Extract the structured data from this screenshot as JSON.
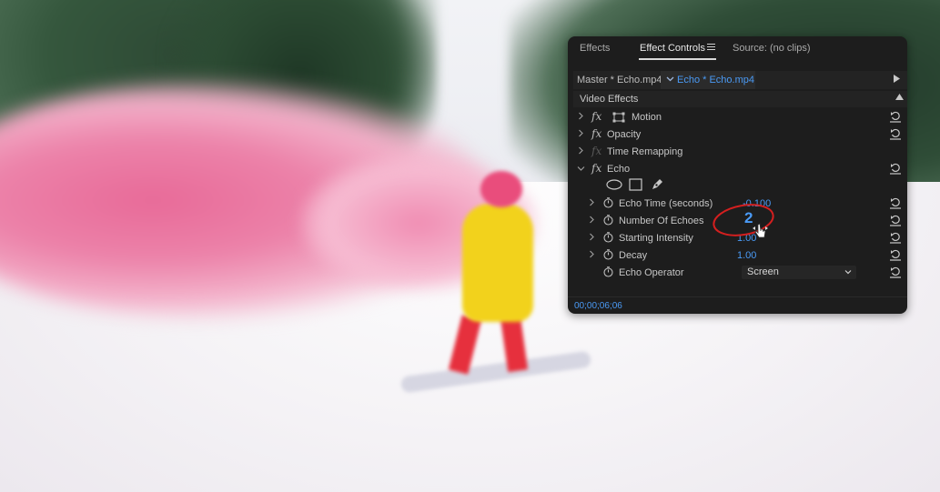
{
  "tabs": {
    "effects": "Effects",
    "effect_controls": "Effect Controls",
    "source": "Source: (no clips)"
  },
  "clips": {
    "master": "Master * Echo.mp4",
    "active": "Echo * Echo.mp4"
  },
  "video_effects": {
    "title": "Video Effects",
    "motion": "Motion",
    "opacity": "Opacity",
    "time_remapping": "Time Remapping",
    "echo": "Echo"
  },
  "echo_params": {
    "echo_time_label": "Echo Time (seconds)",
    "echo_time_value": "-0.100",
    "number_of_echoes_label": "Number Of Echoes",
    "number_of_echoes_value": "2",
    "starting_intensity_label": "Starting Intensity",
    "starting_intensity_value": "1.00",
    "decay_label": "Decay",
    "decay_value": "1.00",
    "echo_operator_label": "Echo Operator",
    "echo_operator_value": "Screen"
  },
  "timecode": "00;00;06;06",
  "colors": {
    "accent_blue": "#4a9af5",
    "panel_bg": "#1d1d1d",
    "annotation_red": "#d41f1f"
  },
  "icons": {
    "fx": "fx",
    "reset": "reset-icon",
    "stopwatch": "stopwatch-icon",
    "ellipse_mask": "ellipse-mask-icon",
    "rect_mask": "rectangle-mask-icon",
    "pen_mask": "pen-mask-icon"
  }
}
